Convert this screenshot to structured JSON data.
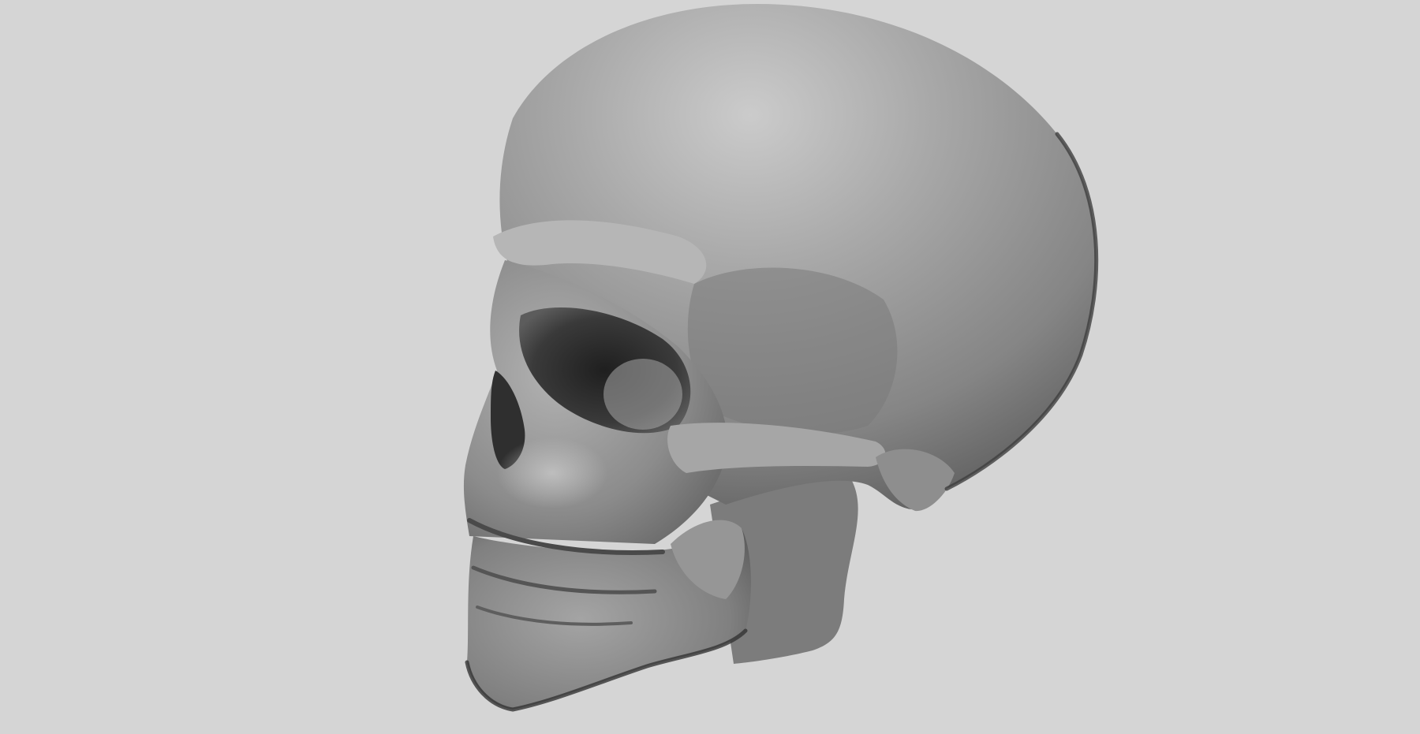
{
  "scene": {
    "subject": "skull-sculpt",
    "colors": {
      "background": "#d5d5d5",
      "surface_mid": "#8a8a8a",
      "surface_light": "#b9b9b9",
      "surface_highlight": "#c9c9c9",
      "surface_dark": "#555555",
      "shadow": "#2a2a2a"
    }
  }
}
